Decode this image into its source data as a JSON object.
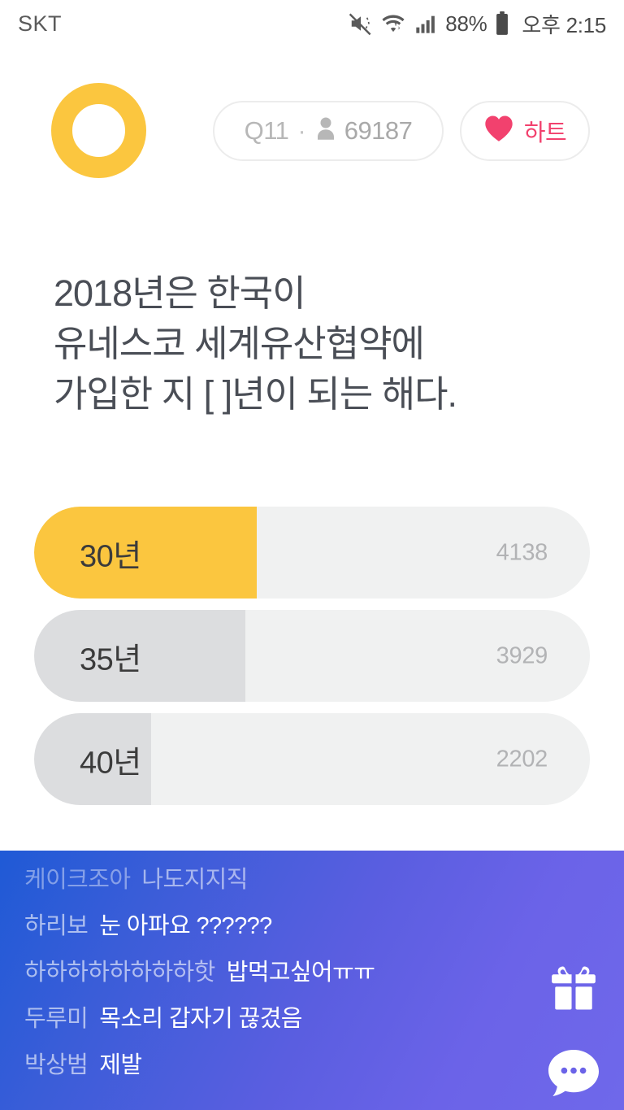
{
  "status_bar": {
    "carrier": "SKT",
    "battery_percent": "88%",
    "time": "오후 2:15",
    "icons": [
      "mute-vibrate-icon",
      "wifi-icon",
      "signal-bars-icon",
      "battery-icon"
    ]
  },
  "header": {
    "logo": "yellow-ring-logo",
    "info_pill": {
      "question_label": "Q11",
      "separator": "·",
      "viewer_icon": "person-icon",
      "viewer_count": "69187"
    },
    "heart_button": {
      "icon": "heart-icon",
      "label": "하트"
    }
  },
  "question": {
    "text": "2018년은 한국이\n유네스코 세계유산협약에\n가입한 지 [   ]년이 되는 해다."
  },
  "chart_data": {
    "type": "bar",
    "title": "2018년은 한국이 유네스코 세계유산협약에 가입한 지 [   ]년이 되는 해다.",
    "categories": [
      "30년",
      "35년",
      "40년"
    ],
    "values": [
      4138,
      3929,
      2202
    ],
    "xlabel": "",
    "ylabel": "",
    "orientation": "horizontal",
    "grid": false,
    "legend": "none",
    "highlighted_index": 0,
    "colors": {
      "selected": "#FBC63F",
      "plain": "#dcdddf",
      "track": "#f0f1f1"
    }
  },
  "answers": [
    {
      "label": "30년",
      "count": "4138",
      "fill_percent": 40,
      "state": "selected"
    },
    {
      "label": "35년",
      "count": "3929",
      "fill_percent": 38,
      "state": "plain"
    },
    {
      "label": "40년",
      "count": "2202",
      "fill_percent": 21,
      "state": "plain"
    }
  ],
  "chat": {
    "messages": [
      {
        "nick": "케이크조아",
        "text": "나도지지직"
      },
      {
        "nick": "하리보",
        "text": "눈 아파요 ??????"
      },
      {
        "nick": "하하하하하하하하핫",
        "text": "밥먹고싶어ㅠㅠ"
      },
      {
        "nick": "두루미",
        "text": "목소리 갑자기 끊겼음"
      },
      {
        "nick": "박상범",
        "text": "제발"
      }
    ],
    "actions": [
      {
        "icon": "gift-icon",
        "name": "gift-button"
      },
      {
        "icon": "chat-bubble-icon",
        "name": "chat-button"
      }
    ]
  },
  "colors": {
    "accent_yellow": "#FBC63F",
    "heart_pink": "#F2416E",
    "chat_gradient_start": "#1f5ad6",
    "chat_gradient_end": "#6f68ea",
    "answer_track": "#f0f1f1",
    "answer_plain_fill": "#dcdddf"
  }
}
